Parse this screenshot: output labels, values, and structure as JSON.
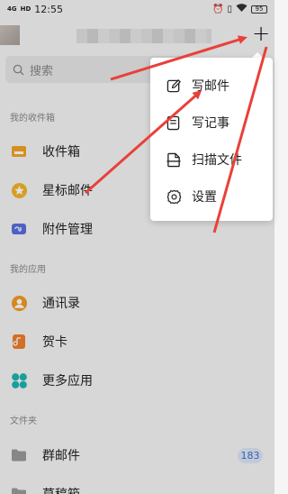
{
  "status_bar": {
    "signal": "4G",
    "network": "HD",
    "time": "12:55",
    "battery": "95"
  },
  "header": {
    "add_label": "+"
  },
  "search": {
    "placeholder": "搜索"
  },
  "sections": {
    "mailboxes": "我的收件箱",
    "apps": "我的应用",
    "folders": "文件夹"
  },
  "mailbox_items": [
    {
      "label": "收件箱",
      "icon": "inbox-icon",
      "color": "#f3a425"
    },
    {
      "label": "星标邮件",
      "icon": "star-icon",
      "color": "#f3b62a"
    },
    {
      "label": "附件管理",
      "icon": "attachment-icon",
      "color": "#5b6ee0"
    }
  ],
  "app_items": [
    {
      "label": "通讯录",
      "icon": "contacts-icon",
      "color": "#f39a25"
    },
    {
      "label": "贺卡",
      "icon": "greeting-card-icon",
      "color": "#f07e2b"
    },
    {
      "label": "更多应用",
      "icon": "more-apps-icon",
      "color": "#1db6b0"
    }
  ],
  "folder_items": [
    {
      "label": "群邮件",
      "icon": "folder-icon",
      "color": "#9a9a9a",
      "count": "183"
    },
    {
      "label": "草稿箱",
      "icon": "folder-icon",
      "color": "#9a9a9a"
    }
  ],
  "menu": {
    "items": [
      {
        "label": "写邮件",
        "icon": "compose-icon"
      },
      {
        "label": "写记事",
        "icon": "note-icon"
      },
      {
        "label": "扫描文件",
        "icon": "scan-icon"
      },
      {
        "label": "设置",
        "icon": "gear-icon"
      }
    ]
  },
  "colors": {
    "arrow": "#e8413a",
    "badge_bg": "#dfe6f5",
    "badge_text": "#3b6fd4"
  }
}
